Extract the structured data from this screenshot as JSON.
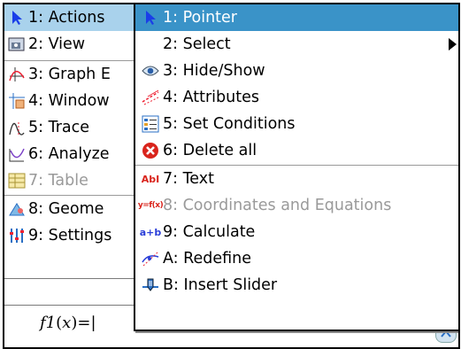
{
  "main_menu": {
    "items": [
      {
        "label": "1: Actions",
        "icon": "pointer-icon",
        "selected": true
      },
      {
        "label": "2: View",
        "icon": "view-icon"
      },
      {
        "label": "3: Graph E",
        "icon": "graph-entry-icon"
      },
      {
        "label": "4: Window",
        "icon": "window-zoom-icon"
      },
      {
        "label": "5: Trace",
        "icon": "trace-icon"
      },
      {
        "label": "6: Analyze",
        "icon": "analyze-icon"
      },
      {
        "label": "7: Table",
        "icon": "table-icon",
        "disabled": true
      },
      {
        "label": "8: Geome",
        "icon": "geometry-icon"
      },
      {
        "label": "9: Settings",
        "icon": "settings-icon"
      }
    ]
  },
  "submenu": {
    "items": [
      {
        "label": "1: Pointer",
        "icon": "pointer-icon",
        "selected": true
      },
      {
        "label": "2: Select",
        "has_submenu": true
      },
      {
        "label": "3: Hide/Show",
        "icon": "eye-icon"
      },
      {
        "label": "4: Attributes",
        "icon": "attributes-icon"
      },
      {
        "label": "5: Set Conditions",
        "icon": "conditions-icon"
      },
      {
        "label": "6: Delete all",
        "icon": "delete-icon"
      },
      {
        "label": "7: Text",
        "icon": "text-icon",
        "icon_text": "AbI"
      },
      {
        "label": "8: Coordinates and Equations",
        "icon": "coordinates-icon",
        "icon_text": "y=f(x)",
        "disabled": true
      },
      {
        "label": "9: Calculate",
        "icon": "calculate-icon",
        "icon_text": "a+b"
      },
      {
        "label": "A: Redefine",
        "icon": "redefine-icon"
      },
      {
        "label": "B: Insert Slider",
        "icon": "slider-icon"
      }
    ]
  },
  "entry_line": {
    "prefix": "f1",
    "open": "(",
    "var": "x",
    "close": ")",
    "equals": "=",
    "cursor": "|"
  },
  "colors": {
    "selected_main": "#a9d2ec",
    "selected_sub": "#3a93c8",
    "disabled": "#9a9a9a"
  }
}
